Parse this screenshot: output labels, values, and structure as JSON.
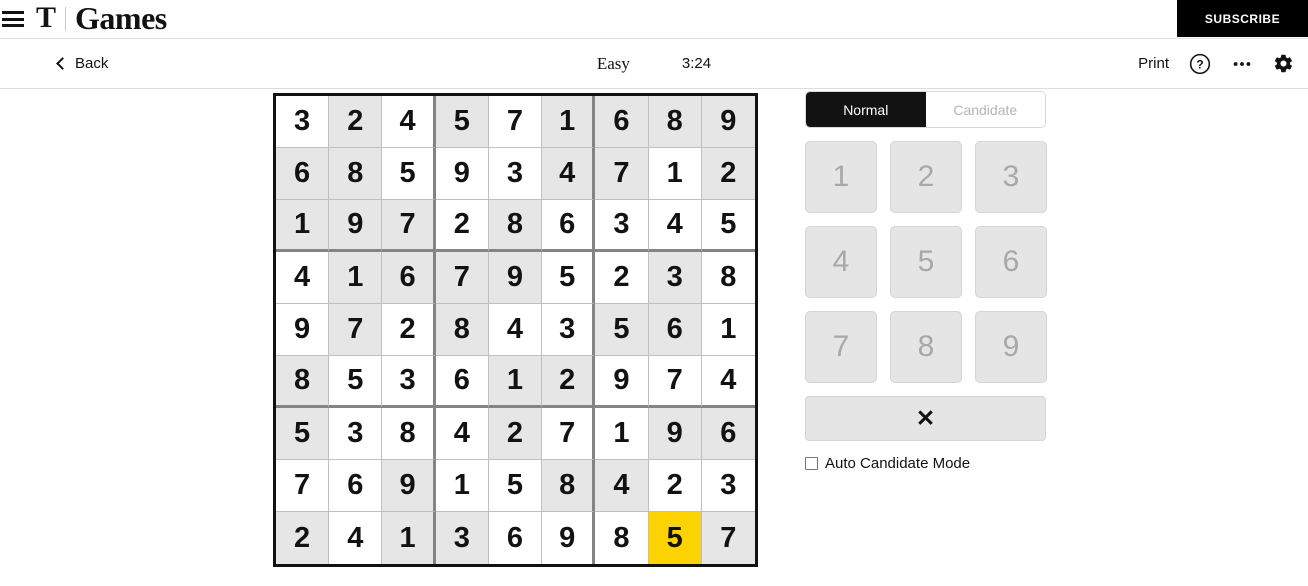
{
  "masthead": {
    "menu_icon": "hamburger-icon",
    "logo_t": "T",
    "logo_word": "Games",
    "subscribe_label": "SUBSCRIBE"
  },
  "toolbar": {
    "back_label": "Back",
    "back_icon": "chevron-left-icon",
    "difficulty": "Easy",
    "timer": "3:24",
    "print_label": "Print",
    "help_icon": "question-circle-icon",
    "more_icon": "ellipsis-icon",
    "settings_icon": "gear-icon"
  },
  "controls": {
    "mode_normal": "Normal",
    "mode_candidate": "Candidate",
    "active_mode": "Normal",
    "numbers": [
      "1",
      "2",
      "3",
      "4",
      "5",
      "6",
      "7",
      "8",
      "9"
    ],
    "erase_icon": "✕",
    "auto_candidate_label": "Auto Candidate Mode",
    "auto_candidate_checked": false
  },
  "colors": {
    "selected_cell": "#fcd200",
    "given_cell": "#e6e6e6",
    "empty_cell": "#ffffff",
    "grid_border": "#121212",
    "text": "#121212"
  },
  "board": {
    "selected_cell": {
      "row": 9,
      "col": 8,
      "value": "5"
    },
    "rows": [
      [
        {
          "v": "3",
          "g": false
        },
        {
          "v": "2",
          "g": true
        },
        {
          "v": "4",
          "g": false
        },
        {
          "v": "5",
          "g": true
        },
        {
          "v": "7",
          "g": false
        },
        {
          "v": "1",
          "g": true
        },
        {
          "v": "6",
          "g": true
        },
        {
          "v": "8",
          "g": true
        },
        {
          "v": "9",
          "g": true
        }
      ],
      [
        {
          "v": "6",
          "g": true
        },
        {
          "v": "8",
          "g": true
        },
        {
          "v": "5",
          "g": false
        },
        {
          "v": "9",
          "g": false
        },
        {
          "v": "3",
          "g": false
        },
        {
          "v": "4",
          "g": true
        },
        {
          "v": "7",
          "g": true
        },
        {
          "v": "1",
          "g": false
        },
        {
          "v": "2",
          "g": true
        }
      ],
      [
        {
          "v": "1",
          "g": true
        },
        {
          "v": "9",
          "g": true
        },
        {
          "v": "7",
          "g": true
        },
        {
          "v": "2",
          "g": false
        },
        {
          "v": "8",
          "g": true
        },
        {
          "v": "6",
          "g": false
        },
        {
          "v": "3",
          "g": false
        },
        {
          "v": "4",
          "g": false
        },
        {
          "v": "5",
          "g": false
        }
      ],
      [
        {
          "v": "4",
          "g": false
        },
        {
          "v": "1",
          "g": true
        },
        {
          "v": "6",
          "g": true
        },
        {
          "v": "7",
          "g": true
        },
        {
          "v": "9",
          "g": true
        },
        {
          "v": "5",
          "g": false
        },
        {
          "v": "2",
          "g": false
        },
        {
          "v": "3",
          "g": true
        },
        {
          "v": "8",
          "g": false
        }
      ],
      [
        {
          "v": "9",
          "g": false
        },
        {
          "v": "7",
          "g": true
        },
        {
          "v": "2",
          "g": false
        },
        {
          "v": "8",
          "g": true
        },
        {
          "v": "4",
          "g": false
        },
        {
          "v": "3",
          "g": false
        },
        {
          "v": "5",
          "g": true
        },
        {
          "v": "6",
          "g": true
        },
        {
          "v": "1",
          "g": false
        }
      ],
      [
        {
          "v": "8",
          "g": true
        },
        {
          "v": "5",
          "g": false
        },
        {
          "v": "3",
          "g": false
        },
        {
          "v": "6",
          "g": false
        },
        {
          "v": "1",
          "g": true
        },
        {
          "v": "2",
          "g": true
        },
        {
          "v": "9",
          "g": false
        },
        {
          "v": "7",
          "g": false
        },
        {
          "v": "4",
          "g": false
        }
      ],
      [
        {
          "v": "5",
          "g": true
        },
        {
          "v": "3",
          "g": false
        },
        {
          "v": "8",
          "g": false
        },
        {
          "v": "4",
          "g": false
        },
        {
          "v": "2",
          "g": true
        },
        {
          "v": "7",
          "g": false
        },
        {
          "v": "1",
          "g": false
        },
        {
          "v": "9",
          "g": true
        },
        {
          "v": "6",
          "g": true
        }
      ],
      [
        {
          "v": "7",
          "g": false
        },
        {
          "v": "6",
          "g": false
        },
        {
          "v": "9",
          "g": true
        },
        {
          "v": "1",
          "g": false
        },
        {
          "v": "5",
          "g": false
        },
        {
          "v": "8",
          "g": true
        },
        {
          "v": "4",
          "g": true
        },
        {
          "v": "2",
          "g": false
        },
        {
          "v": "3",
          "g": false
        }
      ],
      [
        {
          "v": "2",
          "g": true
        },
        {
          "v": "4",
          "g": false
        },
        {
          "v": "1",
          "g": true
        },
        {
          "v": "3",
          "g": true
        },
        {
          "v": "6",
          "g": false
        },
        {
          "v": "9",
          "g": false
        },
        {
          "v": "8",
          "g": false
        },
        {
          "v": "5",
          "g": true,
          "sel": true
        },
        {
          "v": "7",
          "g": true
        }
      ]
    ]
  }
}
